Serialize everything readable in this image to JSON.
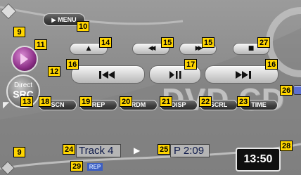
{
  "callouts": {
    "c9a": "9",
    "c10": "10",
    "c11": "11",
    "c12": "12",
    "c13": "13",
    "c14": "14",
    "c15a": "15",
    "c15b": "15",
    "c16a": "16",
    "c16b": "16",
    "c17": "17",
    "c18": "18",
    "c19": "19",
    "c20": "20",
    "c21": "21",
    "c22": "22",
    "c23": "23",
    "c24": "24",
    "c25": "25",
    "c26": "26",
    "c27": "27",
    "c28": "28",
    "c29": "29",
    "c9b": "9"
  },
  "menu": {
    "label": "MENU",
    "arrow": "▶"
  },
  "direct_src": {
    "line1": "Direct",
    "line2": "SRC"
  },
  "transport": {
    "eject": "▲",
    "rewind": "◀◀",
    "forward": "▶▶",
    "stop": "■",
    "prev": "▶◀◀",
    "play_pause": "▶||",
    "next": "▶▶|"
  },
  "function_keys": {
    "scn": "SCN",
    "rep": "REP",
    "rdm": "RDM",
    "disp": "DISP",
    "scrl": "SCRL",
    "time": "TIME"
  },
  "background_text": "DVD CD",
  "track": {
    "name": "Track 4",
    "play_indicator": "▶",
    "time": "P 2:09"
  },
  "clock": "13:50",
  "rep_indicator": "REP"
}
